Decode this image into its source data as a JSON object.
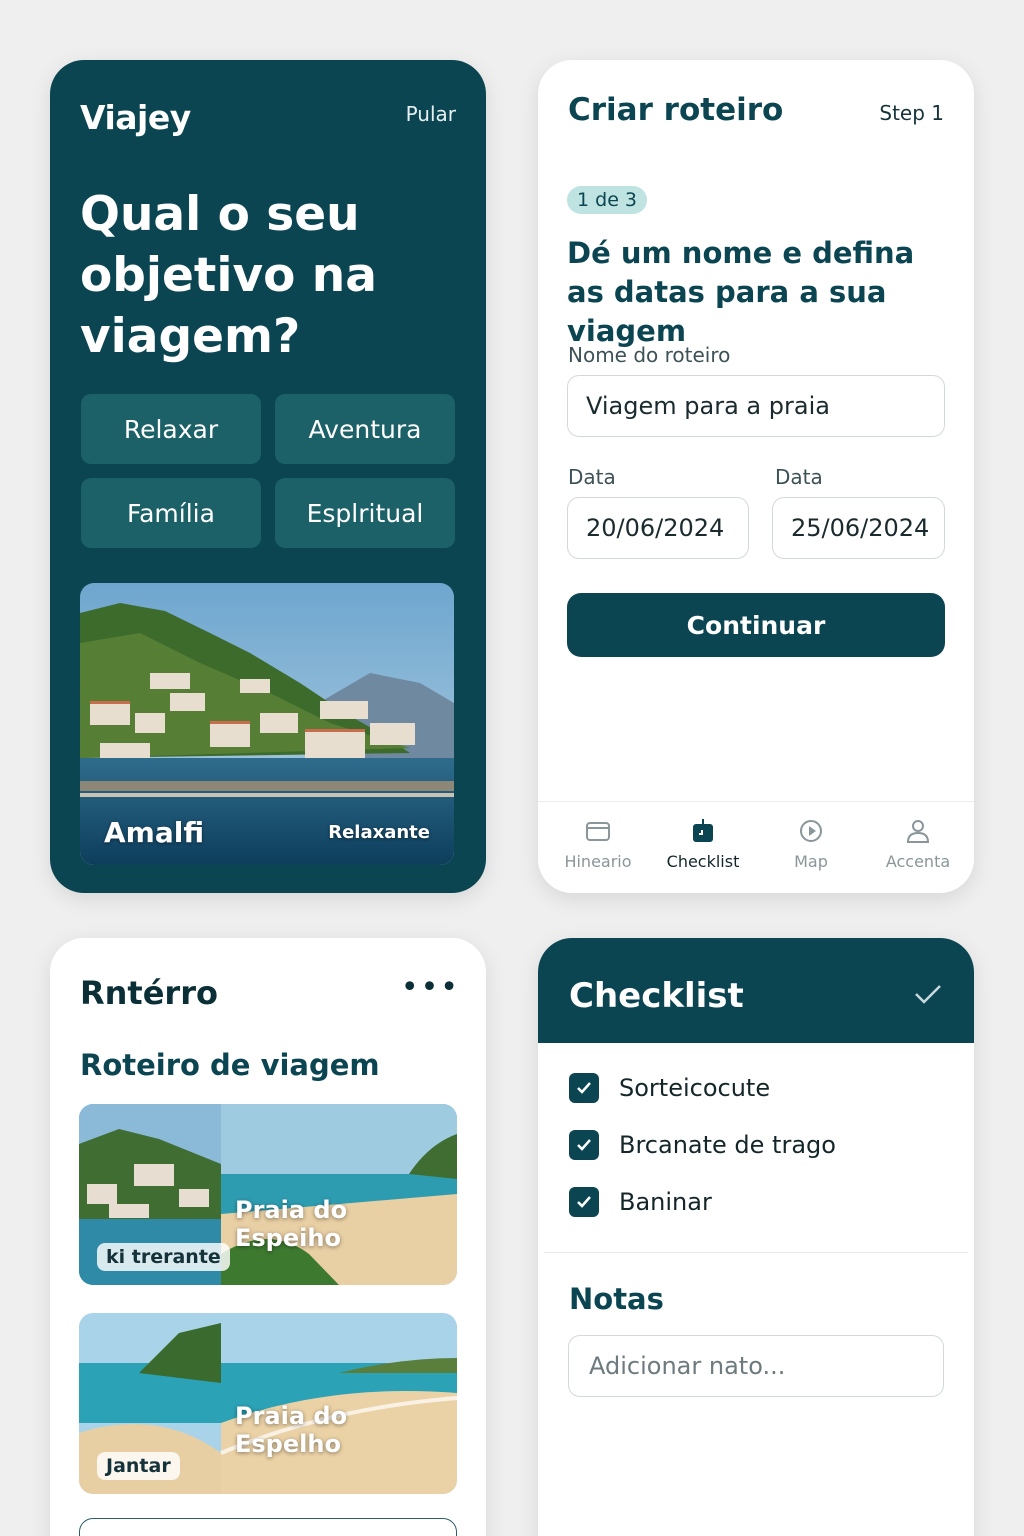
{
  "onboarding": {
    "logo": "Viajey",
    "skip_label": "Pular",
    "question": "Qual o seu objetivo na viagem?",
    "goals": [
      "Relaxar",
      "Aventura",
      "Família",
      "Esplritual"
    ],
    "destination": {
      "name": "Amalfi",
      "tag": "Relaxante"
    }
  },
  "create": {
    "title": "Criar roteiro",
    "step": "Step 1",
    "progress": "1 de 3",
    "heading": "Dé um nome e defina as datas para a sua viagem",
    "name_label": "Nome do roteiro",
    "name_value": "Viagem para a praia",
    "start_label": "Data",
    "start_value": "20/06/2024",
    "end_label": "Data",
    "end_value": "25/06/2024",
    "continue_label": "Continuar",
    "tabs": [
      {
        "label": "Hineario",
        "icon": "card-icon"
      },
      {
        "label": "Checklist",
        "icon": "checklist-icon",
        "active": true
      },
      {
        "label": "Map",
        "icon": "play-circle-icon"
      },
      {
        "label": "Accenta",
        "icon": "user-icon"
      }
    ]
  },
  "itinerary": {
    "brand": "Rntérro",
    "more": "•••",
    "section_title": "Roteiro de viagem",
    "trips": [
      {
        "name": "Praia do Espeiho",
        "chip": "ki trerante"
      },
      {
        "name": "Praia do Espelho",
        "chip": "Jantar"
      }
    ]
  },
  "checklist": {
    "title": "Checklist",
    "items": [
      "Sorteicocute",
      "Brcanate de trago",
      "Baninar"
    ],
    "notes_title": "Notas",
    "notes_placeholder": "Adicionar nato..."
  },
  "colors": {
    "primary": "#0b4552",
    "accent": "#1b6167",
    "pill": "#bfe3e0"
  }
}
